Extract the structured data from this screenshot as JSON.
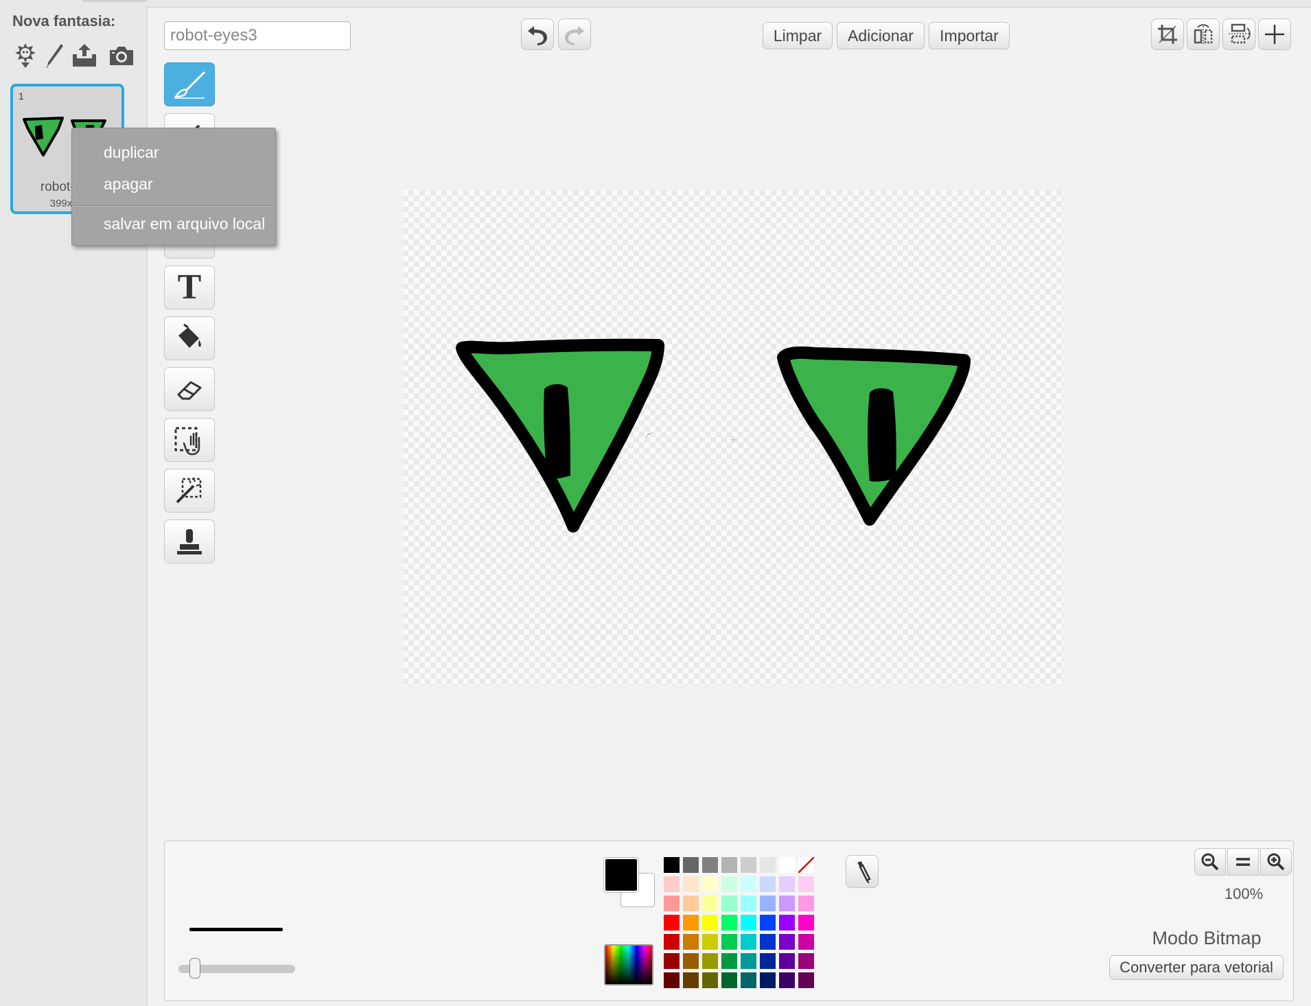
{
  "costume_pane": {
    "new_costume_label": "Nova fantasia:",
    "new_costume_buttons": [
      "choose-costume-from-library-icon",
      "paint-new-costume-icon",
      "upload-costume-icon",
      "camera-icon"
    ],
    "costume": {
      "number": "1",
      "name": "robot-e",
      "size": "399x"
    }
  },
  "context_menu": {
    "items": [
      "duplicar",
      "apagar",
      "salvar em arquivo local"
    ]
  },
  "editor": {
    "costume_name_input": {
      "value": "robot-eyes3"
    },
    "undo_icon": "undo-icon",
    "redo_icon": "redo-icon",
    "toolbar": {
      "clear_label": "Limpar",
      "add_label": "Adicionar",
      "import_label": "Importar"
    },
    "top_right_icons": [
      "crop-icon",
      "flip-horizontal-icon",
      "flip-vertical-icon",
      "set-center-icon"
    ],
    "tools": [
      {
        "name": "brush-tool",
        "icon": "brush-icon",
        "active": true
      },
      {
        "name": "line-tool",
        "icon": "line-icon",
        "active": false
      },
      {
        "name": "rectangle-tool",
        "icon": "rectangle-icon",
        "active": false
      },
      {
        "name": "ellipse-tool",
        "icon": "ellipse-icon",
        "active": false
      },
      {
        "name": "text-tool",
        "icon": "text-icon",
        "glyph": "T",
        "active": false
      },
      {
        "name": "fill-tool",
        "icon": "paint-bucket-icon",
        "active": false
      },
      {
        "name": "eraser-tool",
        "icon": "eraser-icon",
        "active": false
      },
      {
        "name": "select-tool",
        "icon": "select-icon",
        "active": false
      },
      {
        "name": "select-and-erase-tool",
        "icon": "magic-wand-icon",
        "active": false
      },
      {
        "name": "stamp-tool",
        "icon": "stamp-icon",
        "active": false
      }
    ]
  },
  "bottom_panel": {
    "primary_color": "#000000",
    "secondary_color": "#ffffff",
    "palette": [
      [
        "#000000",
        "#666666",
        "#808080",
        "#b3b3b3",
        "#cccccc",
        "#e6e6e6",
        "#ffffff",
        "none"
      ],
      [
        "#ffcccc",
        "#ffe6cc",
        "#ffffcc",
        "#ccffe6",
        "#ccffff",
        "#ccd9ff",
        "#e6ccff",
        "#ffccf2"
      ],
      [
        "#ff9999",
        "#ffcc99",
        "#ffff99",
        "#99ffcc",
        "#99ffff",
        "#99b3ff",
        "#cc99ff",
        "#ff99e6"
      ],
      [
        "#ff0000",
        "#ff9900",
        "#ffff00",
        "#00ff66",
        "#00ffff",
        "#0044ff",
        "#9900ff",
        "#ff00cc"
      ],
      [
        "#cc0000",
        "#cc7a00",
        "#cccc00",
        "#00cc52",
        "#00cccc",
        "#0033cc",
        "#7a00cc",
        "#cc00a3"
      ],
      [
        "#990000",
        "#995c00",
        "#999900",
        "#00993d",
        "#009999",
        "#002699",
        "#5c0099",
        "#99007a"
      ],
      [
        "#660000",
        "#663d00",
        "#666600",
        "#006629",
        "#006666",
        "#001a66",
        "#3d0066",
        "#660052"
      ]
    ],
    "zoom_level": "100%",
    "mode_label": "Modo Bitmap",
    "convert_label": "Converter para vetorial"
  },
  "colors": {
    "eye_fill": "#3bb34a",
    "eye_outline": "#000000",
    "selection_accent": "#29a8e0",
    "active_tool": "#4bb0df"
  }
}
